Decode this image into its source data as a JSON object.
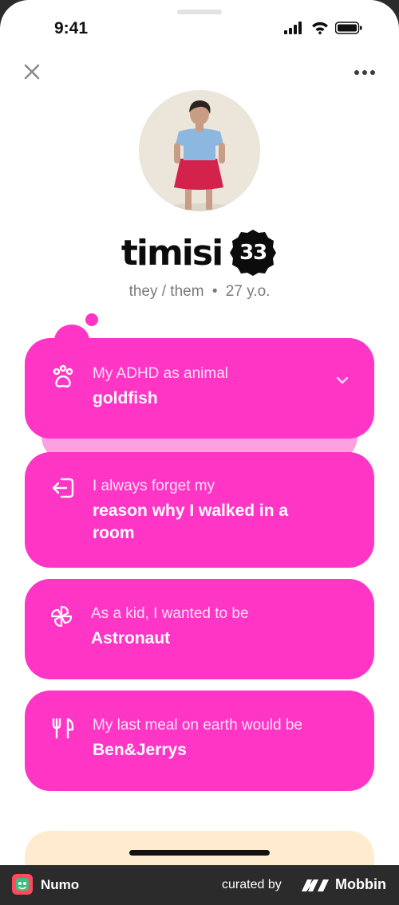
{
  "status_bar": {
    "time": "9:41"
  },
  "profile": {
    "name": "timisi",
    "age_badge": "33",
    "pronouns": "they / them",
    "separator": "•",
    "age_text": "27 y.o."
  },
  "cards": [
    {
      "icon": "paw-icon",
      "label": "My ADHD as animal",
      "value": "goldfish"
    },
    {
      "icon": "exit-door-icon",
      "label": "I always forget my",
      "value_line1": "reason why I walked in a",
      "value_line2": "room"
    },
    {
      "icon": "pinwheel-icon",
      "label": "As a kid, I wanted to be",
      "value": "Astronaut"
    },
    {
      "icon": "fork-knife-icon",
      "label": "My last meal on earth would be",
      "value": "Ben&Jerrys"
    }
  ],
  "colors": {
    "accent": "#ff35c5",
    "accent_light": "#fca0e2",
    "peek_card": "#ffebcf"
  },
  "footer": {
    "app_name": "Numo",
    "curated_by": "curated by",
    "brand": "Mobbin"
  }
}
